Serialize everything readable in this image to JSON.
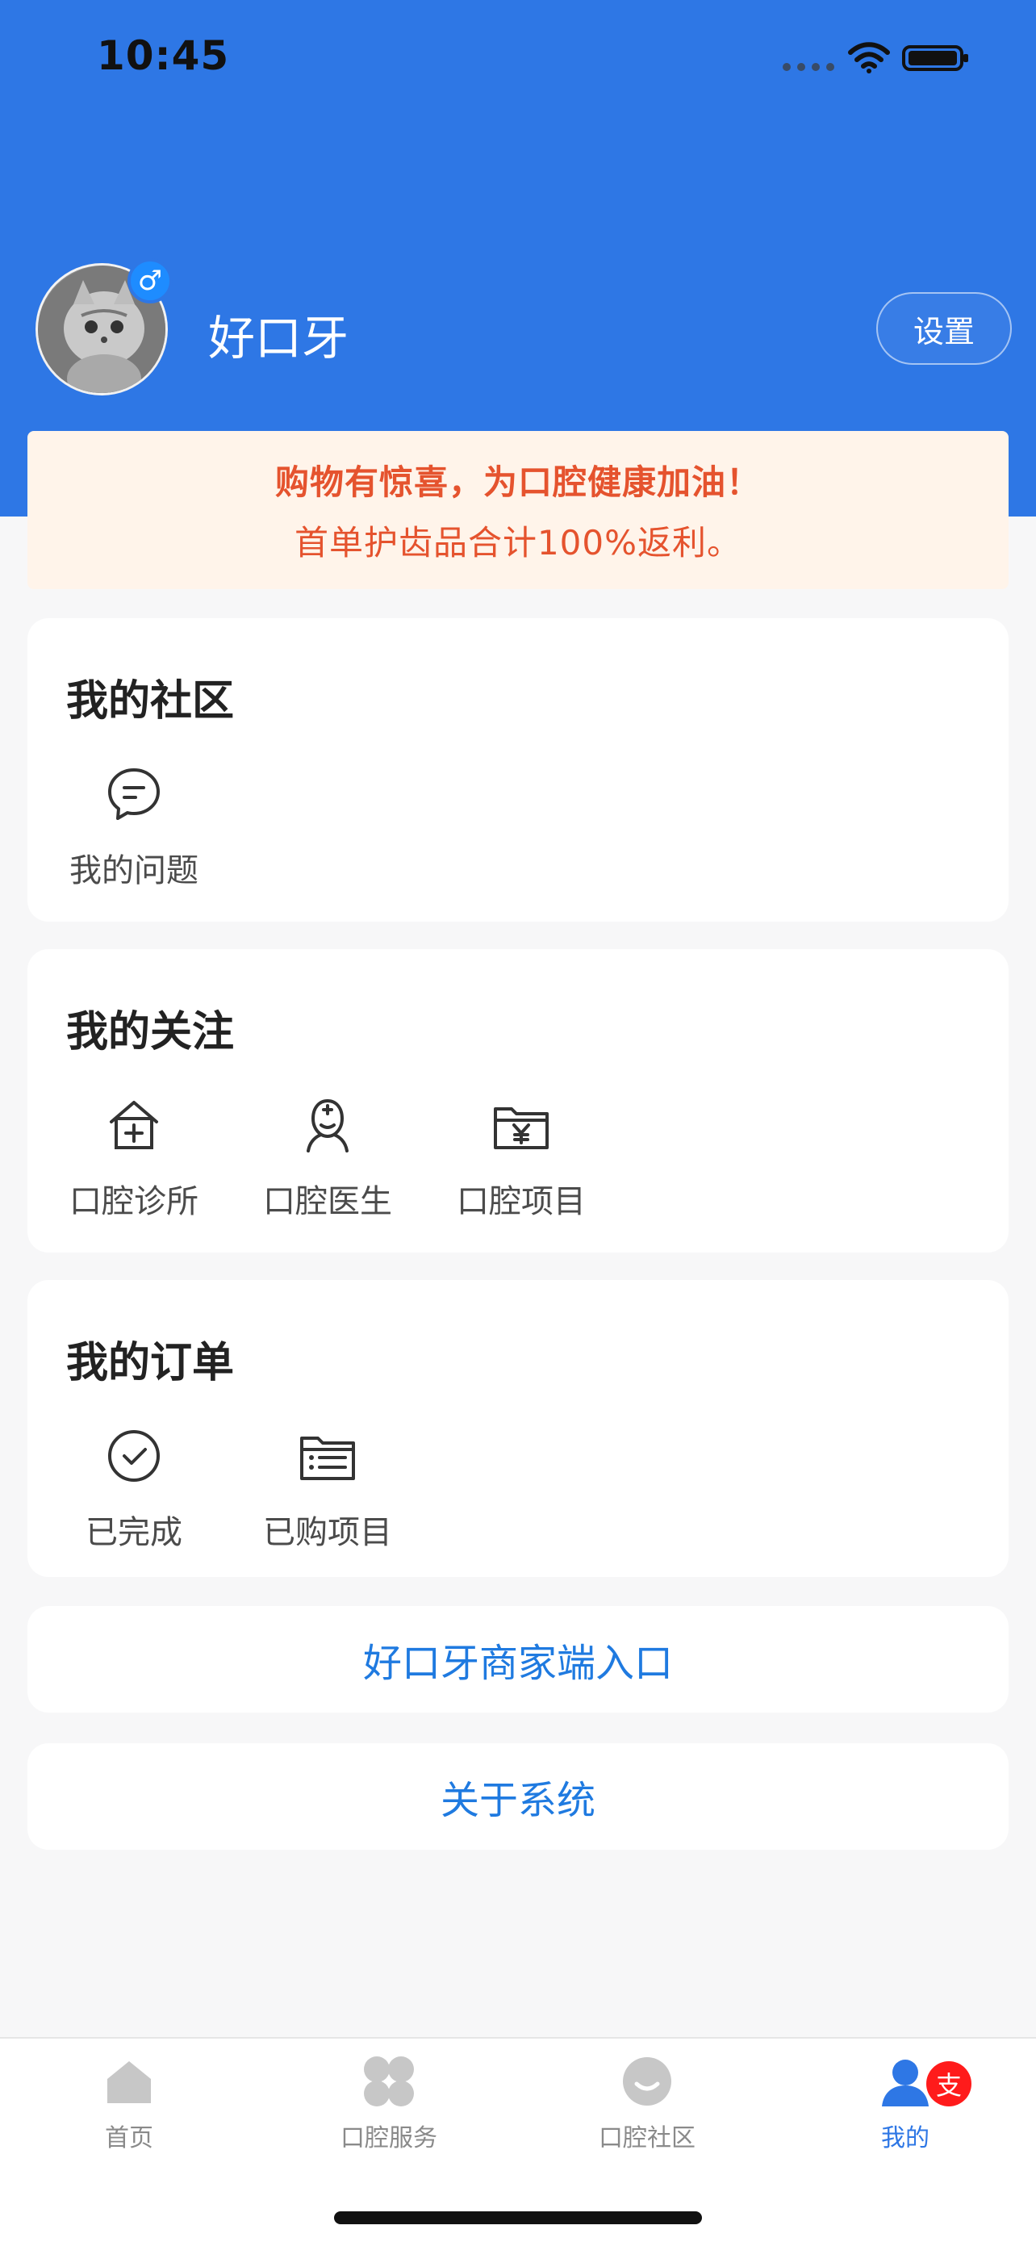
{
  "status": {
    "time": "10:45"
  },
  "profile": {
    "name": "好口牙",
    "gender_symbol": "♂",
    "settings_label": "设置"
  },
  "promo": {
    "line1": "购物有惊喜，为口腔健康加油！",
    "line2": "首单护齿品合计100%返利。"
  },
  "community": {
    "title": "我的社区",
    "items": [
      {
        "label": "我的问题",
        "icon": "chat-bubble-icon"
      }
    ]
  },
  "follow": {
    "title": "我的关注",
    "items": [
      {
        "label": "口腔诊所",
        "icon": "clinic-icon"
      },
      {
        "label": "口腔医生",
        "icon": "doctor-icon"
      },
      {
        "label": "口腔项目",
        "icon": "project-icon"
      }
    ]
  },
  "orders": {
    "title": "我的订单",
    "items": [
      {
        "label": "已完成",
        "icon": "check-circle-icon"
      },
      {
        "label": "已购项目",
        "icon": "list-icon"
      }
    ]
  },
  "links": {
    "merchant": "好口牙商家端入口",
    "about": "关于系统"
  },
  "tabbar": {
    "tabs": [
      {
        "label": "首页",
        "icon": "home-icon"
      },
      {
        "label": "口腔服务",
        "icon": "service-icon"
      },
      {
        "label": "口腔社区",
        "icon": "community-icon"
      },
      {
        "label": "我的",
        "icon": "profile-icon"
      }
    ],
    "badge": "支"
  },
  "colors": {
    "primary": "#2e77e5",
    "promo_bg": "#fff4ea",
    "promo_text": "#e5532e",
    "badge": "#ff1b1b"
  }
}
